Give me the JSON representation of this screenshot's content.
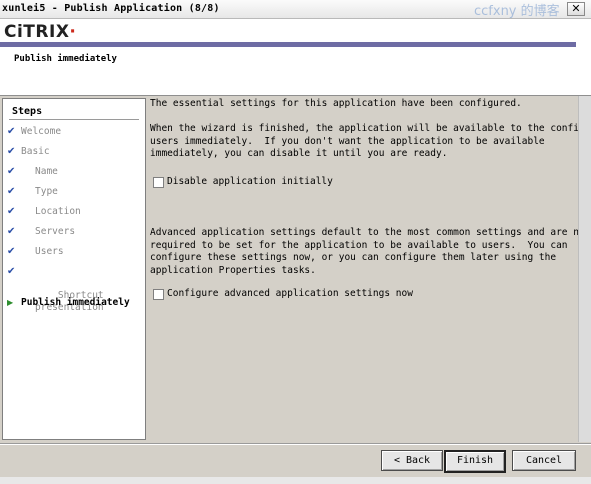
{
  "window": {
    "title": "xunlei5 - Publish Application (8/8)",
    "watermark": "ccfxny 的博客",
    "close_symbol": "✕"
  },
  "header": {
    "logo_text": "CiTRIX",
    "logo_dot": "·",
    "page_title": "Publish immediately"
  },
  "steps": {
    "title": "Steps",
    "items": [
      {
        "label": "Welcome",
        "mark": "✔"
      },
      {
        "label": "Basic",
        "mark": "✔"
      },
      {
        "label": "Name",
        "mark": "✔"
      },
      {
        "label": "Type",
        "mark": "✔"
      },
      {
        "label": "Location",
        "mark": "✔"
      },
      {
        "label": "Servers",
        "mark": "✔"
      },
      {
        "label": "Users",
        "mark": "✔"
      },
      {
        "label": "Shortcut\npresentation",
        "mark": "✔"
      },
      {
        "label": "Publish immediately",
        "mark": "▶"
      }
    ]
  },
  "content": {
    "intro": "The essential settings for this application have been configured.",
    "para1": "When the wizard is finished, the application will be available to the configured\nusers immediately.  If you don't want the application to be available\nimmediately, you can disable it until you are ready.",
    "disable_label": "Disable application initially",
    "disable_checked": false,
    "para2": "Advanced application settings default to the most common settings and are not\nrequired to be set for the application to be available to users.  You can\nconfigure these settings now, or you can configure them later using the\napplication Properties tasks.",
    "configure_label": "Configure advanced application settings now",
    "configure_checked": false
  },
  "buttons": {
    "back": "< Back",
    "finish": "Finish",
    "cancel": "Cancel"
  },
  "colors": {
    "accent_bar": "#6e6ca4",
    "logo_dot": "#cc2a1c",
    "check": "#2b4fa8",
    "current_arrow": "#2d8d2d"
  }
}
